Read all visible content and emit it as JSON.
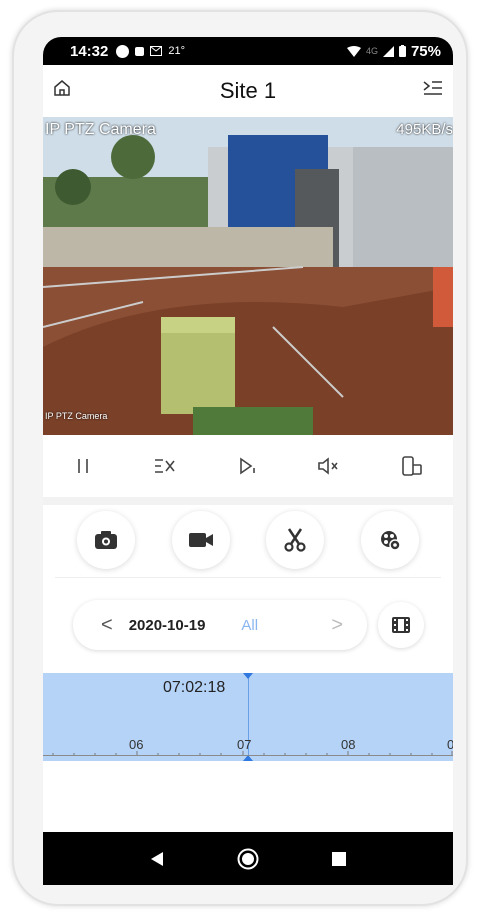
{
  "status_bar": {
    "time": "14:32",
    "temperature": "21°",
    "network": "4G",
    "battery": "75%"
  },
  "header": {
    "title": "Site 1"
  },
  "video": {
    "camera_label": "IP PTZ Camera",
    "bitrate": "495KB/s",
    "camera_label_small": "IP PTZ Camera"
  },
  "controls": [
    "pause-icon",
    "stream-icon",
    "playback-icon",
    "mute-icon",
    "rotate-icon"
  ],
  "actions": [
    "snapshot-icon",
    "record-icon",
    "clip-icon",
    "settings-icon"
  ],
  "date_bar": {
    "prev": "<",
    "date": "2020-10-19",
    "filter": "All",
    "next": ">"
  },
  "timeline": {
    "current_time": "07:02:18",
    "hours": [
      "06",
      "07",
      "08",
      "0"
    ]
  },
  "navbar": [
    "back-icon",
    "home-icon",
    "recents-icon"
  ],
  "colors": {
    "accent": "#2f78e0",
    "timeline_bg": "#b5d3f7",
    "filter": "#8ab6f0"
  }
}
